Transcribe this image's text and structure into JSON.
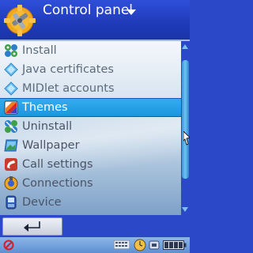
{
  "header": {
    "title": "Control panel",
    "app_icon": "gear-tools-icon",
    "title_dropdown_icon": "caret-down-icon"
  },
  "list": {
    "items": [
      {
        "label": "Install",
        "icon": "install-icon",
        "state": "dim"
      },
      {
        "label": "Java certificates",
        "icon": "certificate-diamond-icon",
        "state": "dim"
      },
      {
        "label": "MIDlet accounts",
        "icon": "midlet-diamond-icon",
        "state": "dim"
      },
      {
        "label": "Themes",
        "icon": "themes-icon",
        "state": "selected"
      },
      {
        "label": "Uninstall",
        "icon": "uninstall-icon",
        "state": "normal"
      },
      {
        "label": "Wallpaper",
        "icon": "wallpaper-icon",
        "state": "normal"
      },
      {
        "label": "Call settings",
        "icon": "call-settings-icon",
        "state": "normal"
      },
      {
        "label": "Connections",
        "icon": "connections-icon",
        "state": "normal"
      },
      {
        "label": "Device",
        "icon": "device-icon",
        "state": "normal"
      }
    ]
  },
  "softkeys": {
    "back_icon": "return-arrow-icon"
  },
  "status": {
    "icons": [
      "no-signal-icon",
      "keypad-icon",
      "clock-icon",
      "device-connected-icon",
      "battery-icon"
    ]
  },
  "colors": {
    "header_bg": "#2f4fd9",
    "selection": "#1f9fe6",
    "text": "#4b5466"
  }
}
